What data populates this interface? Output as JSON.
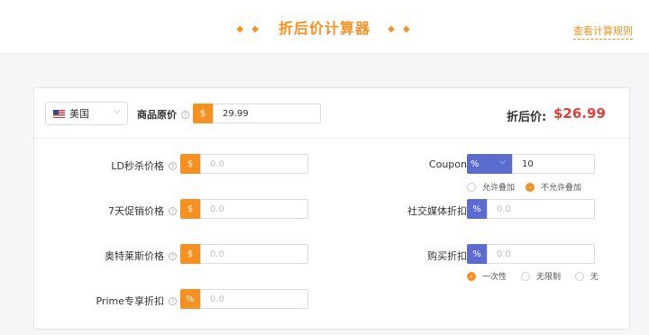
{
  "header": {
    "title": "折后价计算器",
    "diamonds": "◆ ◆",
    "rules_link": "查看计算规则"
  },
  "country": {
    "flag": "us-flag-icon",
    "name": "美国"
  },
  "original_price": {
    "label": "商品原价",
    "currency": "$",
    "value": "29.99"
  },
  "result": {
    "label": "折后价:",
    "value": "$26.99"
  },
  "left_fields": [
    {
      "label": "LD秒杀价格",
      "prefix": "$",
      "placeholder": "0.0"
    },
    {
      "label": "7天促销价格",
      "prefix": "$",
      "placeholder": "0.0"
    },
    {
      "label": "奥特莱斯价格",
      "prefix": "$",
      "placeholder": "0.0"
    },
    {
      "label": "Prime专享折扣",
      "prefix": "%",
      "placeholder": "0.0"
    }
  ],
  "coupon": {
    "label": "Coupon",
    "type_selected": "%",
    "value": "10",
    "stack_options": [
      {
        "label": "允许叠加",
        "selected": false
      },
      {
        "label": "不允许叠加",
        "selected": true
      }
    ]
  },
  "social_discount": {
    "label": "社交媒体折扣",
    "prefix": "%",
    "placeholder": "0.0"
  },
  "purchase_discount": {
    "label": "购买折扣",
    "prefix": "%",
    "placeholder": "0.0",
    "limit_options": [
      {
        "label": "一次性",
        "selected": true
      },
      {
        "label": "无限制",
        "selected": false
      },
      {
        "label": "无",
        "selected": false
      }
    ]
  },
  "colors": {
    "accent": "#f7901e",
    "secondary": "#5c6bcf",
    "price": "#e2403a"
  },
  "help_icon": "?"
}
